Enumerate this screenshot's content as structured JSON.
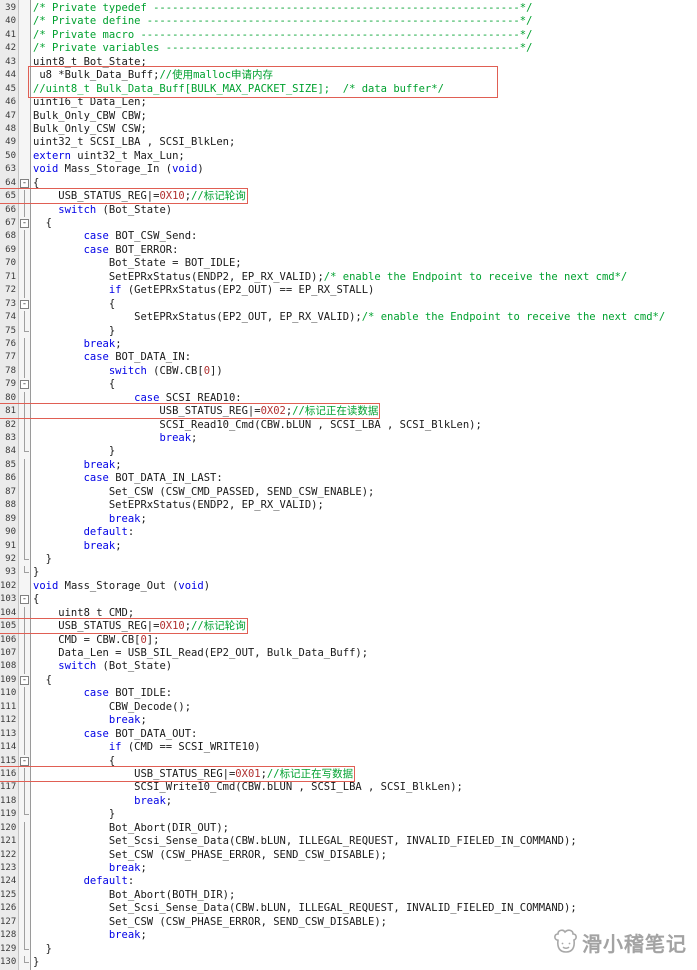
{
  "editor": {
    "colors": {
      "background": "#ffffff",
      "gutter_background": "#ebebeb",
      "keyword": "#0000e6",
      "comment": "#00a12f",
      "number": "#b03030",
      "text": "#1a1a1a",
      "annotation_box": "#e05f54",
      "watermark": "#a3a3a3"
    },
    "segment_types": {
      "c": "plain-code",
      "k": "keyword",
      "m": "comment",
      "n": "number"
    },
    "lines": [
      {
        "n": 39,
        "f": "",
        "hl": false,
        "s": [
          [
            "m",
            "/* Private typedef ----------------------------------------------------------*/"
          ]
        ]
      },
      {
        "n": 40,
        "f": "",
        "hl": false,
        "s": [
          [
            "m",
            "/* Private define -----------------------------------------------------------*/"
          ]
        ]
      },
      {
        "n": 41,
        "f": "",
        "hl": false,
        "s": [
          [
            "m",
            "/* Private macro ------------------------------------------------------------*/"
          ]
        ]
      },
      {
        "n": 42,
        "f": "",
        "hl": false,
        "s": [
          [
            "m",
            "/* Private variables --------------------------------------------------------*/"
          ]
        ]
      },
      {
        "n": 43,
        "f": "",
        "hl": false,
        "s": [
          [
            "c",
            "uint8_t Bot_State;"
          ]
        ]
      },
      {
        "n": 44,
        "f": "",
        "hl": false,
        "s": [
          [
            "c",
            " u8 *Bulk_Data_Buff;"
          ],
          [
            "m",
            "//使用malloc申请内存"
          ]
        ]
      },
      {
        "n": 45,
        "f": "",
        "hl": false,
        "s": [
          [
            "m",
            "//uint8_t Bulk_Data_Buff[BULK_MAX_PACKET_SIZE];  /* data buffer*/"
          ]
        ]
      },
      {
        "n": 46,
        "f": "",
        "hl": false,
        "s": [
          [
            "c",
            "uint16_t Data_Len;"
          ]
        ]
      },
      {
        "n": 47,
        "f": "",
        "hl": false,
        "s": [
          [
            "c",
            "Bulk_Only_CBW CBW;"
          ]
        ]
      },
      {
        "n": 48,
        "f": "",
        "hl": false,
        "s": [
          [
            "c",
            "Bulk_Only_CSW CSW;"
          ]
        ]
      },
      {
        "n": 49,
        "f": "",
        "hl": false,
        "s": [
          [
            "c",
            "uint32_t SCSI_LBA , SCSI_BlkLen;"
          ]
        ]
      },
      {
        "n": 50,
        "f": "",
        "hl": false,
        "s": [
          [
            "k",
            "extern"
          ],
          [
            "c",
            " uint32_t Max_Lun;"
          ]
        ]
      },
      {
        "n": 63,
        "f": "",
        "hl": false,
        "s": [
          [
            "k",
            "void"
          ],
          [
            "c",
            " Mass_Storage_In ("
          ],
          [
            "k",
            "void"
          ],
          [
            "c",
            ")"
          ]
        ]
      },
      {
        "n": 64,
        "f": "b",
        "hl": false,
        "s": [
          [
            "c",
            "{"
          ]
        ]
      },
      {
        "n": 65,
        "f": "l",
        "hl": true,
        "s": [
          [
            "c",
            "    USB_STATUS_REG|="
          ],
          [
            "n",
            "0X10"
          ],
          [
            "c",
            ";"
          ],
          [
            "m",
            "//标记轮询"
          ]
        ]
      },
      {
        "n": 66,
        "f": "l",
        "hl": false,
        "s": [
          [
            "c",
            "    "
          ],
          [
            "k",
            "switch"
          ],
          [
            "c",
            " (Bot_State)"
          ]
        ]
      },
      {
        "n": 67,
        "f": "b",
        "hl": false,
        "s": [
          [
            "c",
            "  {"
          ]
        ]
      },
      {
        "n": 68,
        "f": "l",
        "hl": false,
        "s": [
          [
            "c",
            "        "
          ],
          [
            "k",
            "case"
          ],
          [
            "c",
            " BOT_CSW_Send:"
          ]
        ]
      },
      {
        "n": 69,
        "f": "l",
        "hl": false,
        "s": [
          [
            "c",
            "        "
          ],
          [
            "k",
            "case"
          ],
          [
            "c",
            " BOT_ERROR:"
          ]
        ]
      },
      {
        "n": 70,
        "f": "l",
        "hl": false,
        "s": [
          [
            "c",
            "            Bot_State = BOT_IDLE;"
          ]
        ]
      },
      {
        "n": 71,
        "f": "l",
        "hl": false,
        "s": [
          [
            "c",
            "            SetEPRxStatus(ENDP2, EP_RX_VALID);"
          ],
          [
            "m",
            "/* enable the Endpoint to receive the next cmd*/"
          ]
        ]
      },
      {
        "n": 72,
        "f": "l",
        "hl": false,
        "s": [
          [
            "c",
            "            "
          ],
          [
            "k",
            "if"
          ],
          [
            "c",
            " (GetEPRxStatus(EP2_OUT) == EP_RX_STALL)"
          ]
        ]
      },
      {
        "n": 73,
        "f": "b",
        "hl": false,
        "s": [
          [
            "c",
            "            {"
          ]
        ]
      },
      {
        "n": 74,
        "f": "l",
        "hl": false,
        "s": [
          [
            "c",
            "                SetEPRxStatus(EP2_OUT, EP_RX_VALID);"
          ],
          [
            "m",
            "/* enable the Endpoint to receive the next cmd*/"
          ]
        ]
      },
      {
        "n": 75,
        "f": "e",
        "hl": false,
        "s": [
          [
            "c",
            "            }"
          ]
        ]
      },
      {
        "n": 76,
        "f": "l",
        "hl": false,
        "s": [
          [
            "c",
            "        "
          ],
          [
            "k",
            "break"
          ],
          [
            "c",
            ";"
          ]
        ]
      },
      {
        "n": 77,
        "f": "l",
        "hl": false,
        "s": [
          [
            "c",
            "        "
          ],
          [
            "k",
            "case"
          ],
          [
            "c",
            " BOT_DATA_IN:"
          ]
        ]
      },
      {
        "n": 78,
        "f": "l",
        "hl": false,
        "s": [
          [
            "c",
            "            "
          ],
          [
            "k",
            "switch"
          ],
          [
            "c",
            " (CBW.CB["
          ],
          [
            "n",
            "0"
          ],
          [
            "c",
            "])"
          ]
        ]
      },
      {
        "n": 79,
        "f": "b",
        "hl": false,
        "s": [
          [
            "c",
            "            {"
          ]
        ]
      },
      {
        "n": 80,
        "f": "l",
        "hl": false,
        "s": [
          [
            "c",
            "                "
          ],
          [
            "k",
            "case"
          ],
          [
            "c",
            " SCSI_READ10:"
          ]
        ]
      },
      {
        "n": 81,
        "f": "l",
        "hl": true,
        "s": [
          [
            "c",
            "                    USB_STATUS_REG|="
          ],
          [
            "n",
            "0X02"
          ],
          [
            "c",
            ";"
          ],
          [
            "m",
            "//标记正在读数据"
          ]
        ]
      },
      {
        "n": 82,
        "f": "l",
        "hl": false,
        "s": [
          [
            "c",
            "                    SCSI_Read10_Cmd(CBW.bLUN , SCSI_LBA , SCSI_BlkLen);"
          ]
        ]
      },
      {
        "n": 83,
        "f": "l",
        "hl": false,
        "s": [
          [
            "c",
            "                    "
          ],
          [
            "k",
            "break"
          ],
          [
            "c",
            ";"
          ]
        ]
      },
      {
        "n": 84,
        "f": "e",
        "hl": false,
        "s": [
          [
            "c",
            "            }"
          ]
        ]
      },
      {
        "n": 85,
        "f": "l",
        "hl": false,
        "s": [
          [
            "c",
            "        "
          ],
          [
            "k",
            "break"
          ],
          [
            "c",
            ";"
          ]
        ]
      },
      {
        "n": 86,
        "f": "l",
        "hl": false,
        "s": [
          [
            "c",
            "        "
          ],
          [
            "k",
            "case"
          ],
          [
            "c",
            " BOT_DATA_IN_LAST:"
          ]
        ]
      },
      {
        "n": 87,
        "f": "l",
        "hl": false,
        "s": [
          [
            "c",
            "            Set_CSW (CSW_CMD_PASSED, SEND_CSW_ENABLE);"
          ]
        ]
      },
      {
        "n": 88,
        "f": "l",
        "hl": false,
        "s": [
          [
            "c",
            "            SetEPRxStatus(ENDP2, EP_RX_VALID);"
          ]
        ]
      },
      {
        "n": 89,
        "f": "l",
        "hl": false,
        "s": [
          [
            "c",
            "            "
          ],
          [
            "k",
            "break"
          ],
          [
            "c",
            ";"
          ]
        ]
      },
      {
        "n": 90,
        "f": "l",
        "hl": false,
        "s": [
          [
            "c",
            "        "
          ],
          [
            "k",
            "default"
          ],
          [
            "c",
            ":"
          ]
        ]
      },
      {
        "n": 91,
        "f": "l",
        "hl": false,
        "s": [
          [
            "c",
            "        "
          ],
          [
            "k",
            "break"
          ],
          [
            "c",
            ";"
          ]
        ]
      },
      {
        "n": 92,
        "f": "e",
        "hl": false,
        "s": [
          [
            "c",
            "  }"
          ]
        ]
      },
      {
        "n": 93,
        "f": "e",
        "hl": false,
        "s": [
          [
            "c",
            "}"
          ]
        ]
      },
      {
        "n": 102,
        "f": "",
        "hl": false,
        "s": [
          [
            "k",
            "void"
          ],
          [
            "c",
            " Mass_Storage_Out ("
          ],
          [
            "k",
            "void"
          ],
          [
            "c",
            ")"
          ]
        ]
      },
      {
        "n": 103,
        "f": "b",
        "hl": false,
        "s": [
          [
            "c",
            "{"
          ]
        ]
      },
      {
        "n": 104,
        "f": "l",
        "hl": false,
        "s": [
          [
            "c",
            "    uint8_t CMD;"
          ]
        ]
      },
      {
        "n": 105,
        "f": "l",
        "hl": true,
        "s": [
          [
            "c",
            "    USB_STATUS_REG|="
          ],
          [
            "n",
            "0X10"
          ],
          [
            "c",
            ";"
          ],
          [
            "m",
            "//标记轮询"
          ]
        ]
      },
      {
        "n": 106,
        "f": "l",
        "hl": false,
        "s": [
          [
            "c",
            "    CMD = CBW.CB["
          ],
          [
            "n",
            "0"
          ],
          [
            "c",
            "];"
          ]
        ]
      },
      {
        "n": 107,
        "f": "l",
        "hl": false,
        "s": [
          [
            "c",
            "    Data_Len = USB_SIL_Read(EP2_OUT, Bulk_Data_Buff);"
          ]
        ]
      },
      {
        "n": 108,
        "f": "l",
        "hl": false,
        "s": [
          [
            "c",
            "    "
          ],
          [
            "k",
            "switch"
          ],
          [
            "c",
            " (Bot_State)"
          ]
        ]
      },
      {
        "n": 109,
        "f": "b",
        "hl": false,
        "s": [
          [
            "c",
            "  {"
          ]
        ]
      },
      {
        "n": 110,
        "f": "l",
        "hl": false,
        "s": [
          [
            "c",
            "        "
          ],
          [
            "k",
            "case"
          ],
          [
            "c",
            " BOT_IDLE:"
          ]
        ]
      },
      {
        "n": 111,
        "f": "l",
        "hl": false,
        "s": [
          [
            "c",
            "            CBW_Decode();"
          ]
        ]
      },
      {
        "n": 112,
        "f": "l",
        "hl": false,
        "s": [
          [
            "c",
            "            "
          ],
          [
            "k",
            "break"
          ],
          [
            "c",
            ";"
          ]
        ]
      },
      {
        "n": 113,
        "f": "l",
        "hl": false,
        "s": [
          [
            "c",
            "        "
          ],
          [
            "k",
            "case"
          ],
          [
            "c",
            " BOT_DATA_OUT:"
          ]
        ]
      },
      {
        "n": 114,
        "f": "l",
        "hl": false,
        "s": [
          [
            "c",
            "            "
          ],
          [
            "k",
            "if"
          ],
          [
            "c",
            " (CMD == SCSI_WRITE10)"
          ]
        ]
      },
      {
        "n": 115,
        "f": "b",
        "hl": false,
        "s": [
          [
            "c",
            "            {"
          ]
        ]
      },
      {
        "n": 116,
        "f": "l",
        "hl": true,
        "s": [
          [
            "c",
            "                USB_STATUS_REG|="
          ],
          [
            "n",
            "0X01"
          ],
          [
            "c",
            ";"
          ],
          [
            "m",
            "//标记正在写数据"
          ]
        ]
      },
      {
        "n": 117,
        "f": "l",
        "hl": false,
        "s": [
          [
            "c",
            "                SCSI_Write10_Cmd(CBW.bLUN , SCSI_LBA , SCSI_BlkLen);"
          ]
        ]
      },
      {
        "n": 118,
        "f": "l",
        "hl": false,
        "s": [
          [
            "c",
            "                "
          ],
          [
            "k",
            "break"
          ],
          [
            "c",
            ";"
          ]
        ]
      },
      {
        "n": 119,
        "f": "e",
        "hl": false,
        "s": [
          [
            "c",
            "            }"
          ]
        ]
      },
      {
        "n": 120,
        "f": "l",
        "hl": false,
        "s": [
          [
            "c",
            "            Bot_Abort(DIR_OUT);"
          ]
        ]
      },
      {
        "n": 121,
        "f": "l",
        "hl": false,
        "s": [
          [
            "c",
            "            Set_Scsi_Sense_Data(CBW.bLUN, ILLEGAL_REQUEST, INVALID_FIELED_IN_COMMAND);"
          ]
        ]
      },
      {
        "n": 122,
        "f": "l",
        "hl": false,
        "s": [
          [
            "c",
            "            Set_CSW (CSW_PHASE_ERROR, SEND_CSW_DISABLE);"
          ]
        ]
      },
      {
        "n": 123,
        "f": "l",
        "hl": false,
        "s": [
          [
            "c",
            "            "
          ],
          [
            "k",
            "break"
          ],
          [
            "c",
            ";"
          ]
        ]
      },
      {
        "n": 124,
        "f": "l",
        "hl": false,
        "s": [
          [
            "c",
            "        "
          ],
          [
            "k",
            "default"
          ],
          [
            "c",
            ":"
          ]
        ]
      },
      {
        "n": 125,
        "f": "l",
        "hl": false,
        "s": [
          [
            "c",
            "            Bot_Abort(BOTH_DIR);"
          ]
        ]
      },
      {
        "n": 126,
        "f": "l",
        "hl": false,
        "s": [
          [
            "c",
            "            Set_Scsi_Sense_Data(CBW.bLUN, ILLEGAL_REQUEST, INVALID_FIELED_IN_COMMAND);"
          ]
        ]
      },
      {
        "n": 127,
        "f": "l",
        "hl": false,
        "s": [
          [
            "c",
            "            Set_CSW (CSW_PHASE_ERROR, SEND_CSW_DISABLE);"
          ]
        ]
      },
      {
        "n": 128,
        "f": "l",
        "hl": false,
        "s": [
          [
            "c",
            "            "
          ],
          [
            "k",
            "break"
          ],
          [
            "c",
            ";"
          ]
        ]
      },
      {
        "n": 129,
        "f": "e",
        "hl": false,
        "s": [
          [
            "c",
            "  }"
          ]
        ]
      },
      {
        "n": 130,
        "f": "e",
        "hl": false,
        "s": [
          [
            "c",
            "}"
          ]
        ]
      }
    ],
    "annotations": {
      "multi_line_box_lines": [
        44,
        45
      ],
      "single_line_box_lines": [
        65,
        81,
        105,
        116
      ]
    }
  },
  "watermark": {
    "text": "滑小稽笔记",
    "icon": "chef-face-icon"
  }
}
